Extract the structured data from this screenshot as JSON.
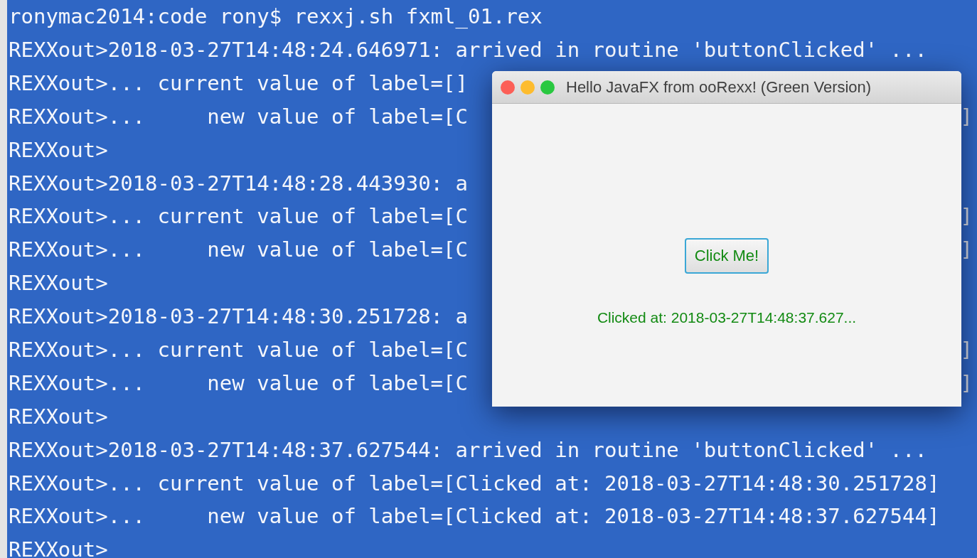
{
  "terminal": {
    "lines": [
      {
        "text": "ronymac2014:code rony$ rexxj.sh fxml_01.rex"
      },
      {
        "text": "REXXout>2018-03-27T14:48:24.646971: arrived in routine 'buttonClicked' ..."
      },
      {
        "text": "REXXout>... current value of label=[]"
      },
      {
        "text": "REXXout>...     new value of label=[C",
        "right": "]"
      },
      {
        "text": "REXXout>"
      },
      {
        "text": "REXXout>2018-03-27T14:48:28.443930: a"
      },
      {
        "text": "REXXout>... current value of label=[C",
        "right": "]"
      },
      {
        "text": "REXXout>...     new value of label=[C",
        "right": "]"
      },
      {
        "text": "REXXout>"
      },
      {
        "text": "REXXout>2018-03-27T14:48:30.251728: a"
      },
      {
        "text": "REXXout>... current value of label=[C",
        "right": "]"
      },
      {
        "text": "REXXout>...     new value of label=[C",
        "right": "]"
      },
      {
        "text": "REXXout>"
      },
      {
        "text": "REXXout>2018-03-27T14:48:37.627544: arrived in routine 'buttonClicked' ..."
      },
      {
        "text": "REXXout>... current value of label=[Clicked at: 2018-03-27T14:48:30.251728]"
      },
      {
        "text": "REXXout>...     new value of label=[Clicked at: 2018-03-27T14:48:37.627544]"
      },
      {
        "text": "REXXout>"
      }
    ]
  },
  "window": {
    "title": "Hello JavaFX from ooRexx! (Green Version)",
    "button": "Click Me!",
    "label": "Clicked at: 2018-03-27T14:48:37.627..."
  }
}
